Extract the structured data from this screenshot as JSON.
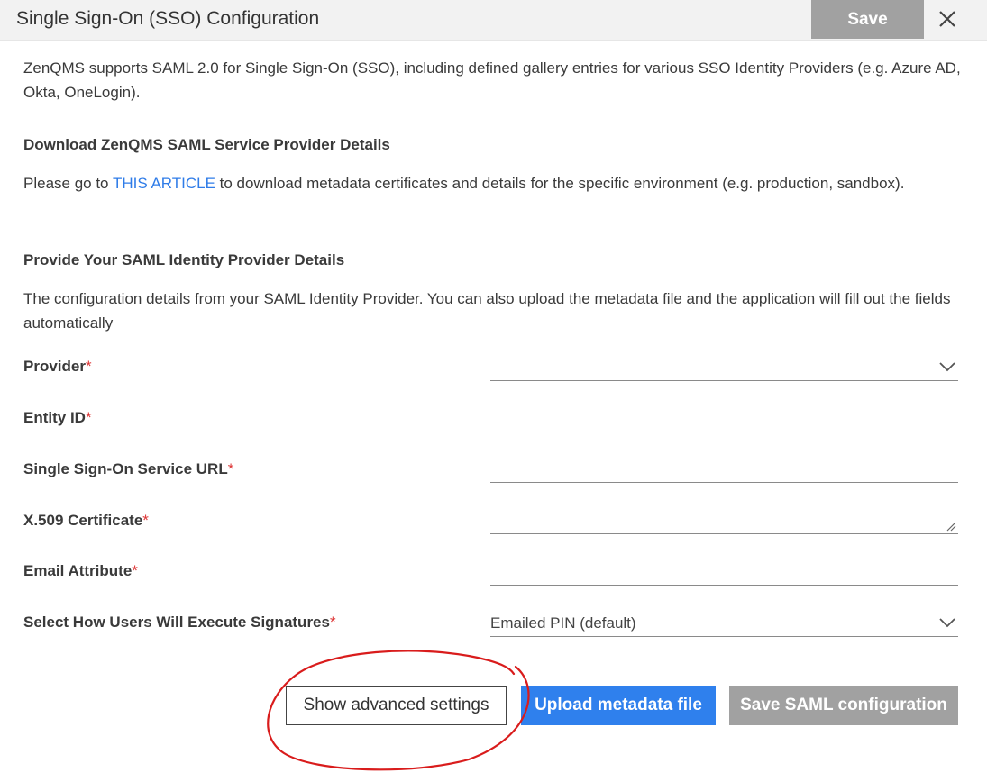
{
  "header": {
    "title": "Single Sign-On (SSO) Configuration",
    "save_label": "Save"
  },
  "intro": "ZenQMS supports SAML 2.0 for Single Sign-On (SSO), including defined gallery entries for various SSO Identity Providers (e.g. Azure AD, Okta, OneLogin).",
  "download": {
    "heading": "Download ZenQMS SAML Service Provider Details",
    "text_before": "Please go to ",
    "link_label": "THIS ARTICLE",
    "text_after": " to download metadata certificates and details for the specific environment (e.g. production, sandbox)."
  },
  "provide": {
    "heading": "Provide Your SAML Identity Provider Details",
    "text": "The configuration details from your SAML Identity Provider. You can also upload the metadata file and the application will fill out the fields automatically"
  },
  "required_mark": "*",
  "fields": {
    "provider": {
      "label": "Provider",
      "value": ""
    },
    "entity_id": {
      "label": "Entity ID",
      "value": ""
    },
    "sso_url": {
      "label": "Single Sign-On Service URL",
      "value": ""
    },
    "certificate": {
      "label": "X.509 Certificate",
      "value": ""
    },
    "email_attribute": {
      "label": "Email Attribute",
      "value": ""
    },
    "signatures": {
      "label": "Select How Users Will Execute Signatures",
      "value": "Emailed PIN (default)"
    }
  },
  "buttons": {
    "advanced": "Show advanced settings",
    "upload": "Upload metadata file",
    "save_saml": "Save SAML configuration"
  },
  "colors": {
    "link": "#2f7ce8",
    "primary": "#2f80ed",
    "disabled": "#a1a1a1",
    "required": "#dd3333",
    "annotation": "#d91c1c"
  },
  "icons": {
    "close": "close-icon",
    "dropdown": "chevron-down-icon",
    "resize": "resize-handle-icon"
  }
}
